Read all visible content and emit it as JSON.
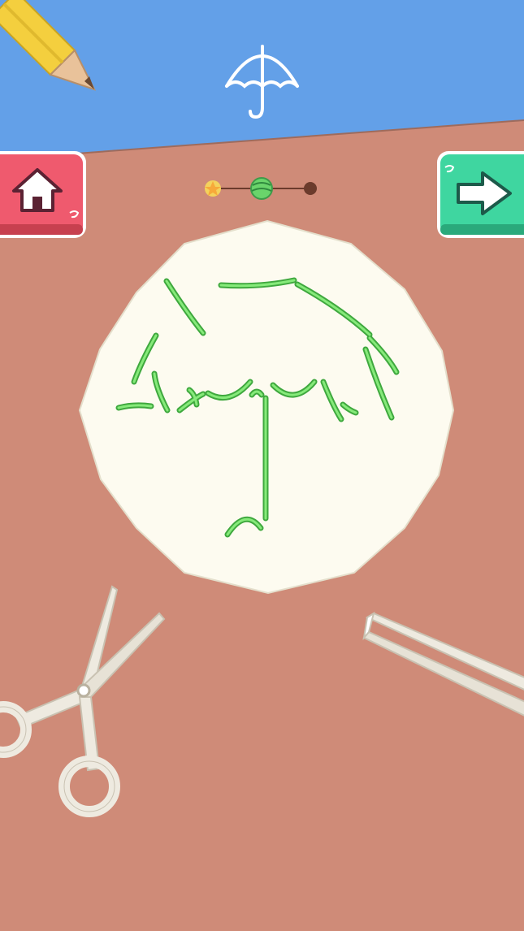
{
  "target_shape": {
    "icon": "umbrella-icon"
  },
  "buttons": {
    "home": {
      "icon": "home-icon",
      "color": "#ef5a6e"
    },
    "next": {
      "icon": "arrow-right-icon",
      "color": "#3fd6a0"
    }
  },
  "level_progress": {
    "steps": 3,
    "current_step": 2,
    "markers": [
      "star-icon",
      "ball-icon",
      "dot-icon"
    ]
  },
  "tools": [
    "scissors-icon",
    "tweezers-icon",
    "pencil-icon"
  ],
  "colors": {
    "sky": "#63a0e8",
    "table": "#cf8b78",
    "paper": "#fdfbf0",
    "stencil_groove": "#62d35a",
    "tool_white": "#eeeae0"
  }
}
